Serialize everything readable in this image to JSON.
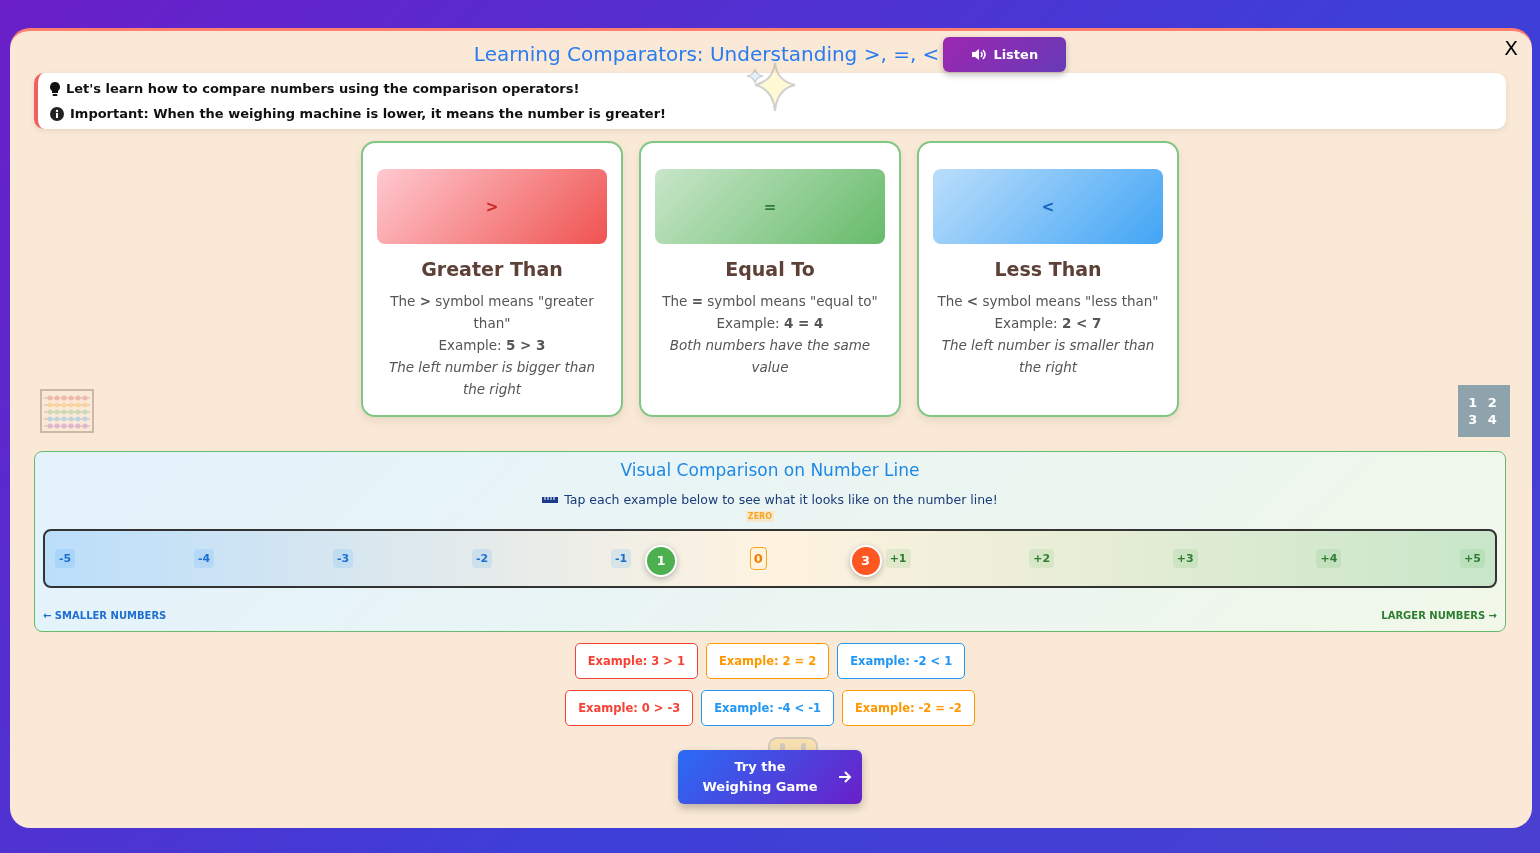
{
  "title": "Learning Comparators: Understanding >, =, <",
  "listen_button": "Listen",
  "close": "X",
  "info": [
    {
      "kind": "tip",
      "text": "Let's learn how to compare numbers using the comparison operators!"
    },
    {
      "kind": "important",
      "text": "Important: When the weighing machine is lower, it means the number is greater!"
    }
  ],
  "cards": [
    {
      "kind": "greater",
      "symbol": ">",
      "title": "Greater Than",
      "description": "The **>** symbol means \"greater than\"",
      "example": "Example: **5 > 3**",
      "note": "The left number is bigger than the right"
    },
    {
      "kind": "equal",
      "symbol": "=",
      "title": "Equal To",
      "description": "The **=** symbol means \"equal to\"",
      "example": "Example: **4 = 4**",
      "note": "Both numbers have the same value"
    },
    {
      "kind": "less",
      "symbol": "<",
      "title": "Less Than",
      "description": "The **<** symbol means \"less than\"",
      "example": "Example: **2 < 7**",
      "note": "The left number is smaller than the right"
    }
  ],
  "decor_numbers": [
    "1 2",
    "3 4"
  ],
  "number_line": {
    "title": "Visual Comparison on Number Line",
    "hint": "Tap each example below to see what it looks like on the number line!",
    "zero_label": "ZERO",
    "ticks": [
      {
        "label": "-5",
        "kind": "negative"
      },
      {
        "label": "-4",
        "kind": "negative"
      },
      {
        "label": "-3",
        "kind": "negative"
      },
      {
        "label": "-2",
        "kind": "negative"
      },
      {
        "label": "-1",
        "kind": "negative",
        "marker": {
          "label": "1",
          "color": "#4caf50",
          "kind": "after"
        }
      },
      {
        "label": "0",
        "kind": "zero"
      },
      {
        "label": "+1",
        "kind": "positive",
        "marker": {
          "label": "3",
          "color": "#ff5722",
          "kind": "before"
        }
      },
      {
        "label": "+2",
        "kind": "positive"
      },
      {
        "label": "+3",
        "kind": "positive"
      },
      {
        "label": "+4",
        "kind": "positive"
      },
      {
        "label": "+5",
        "kind": "positive"
      }
    ],
    "left_caption": "← SMALLER NUMBERS",
    "right_caption": "LARGER NUMBERS →"
  },
  "examples": [
    [
      {
        "label": "Example: 3 > 1",
        "color": "#f44336"
      },
      {
        "label": "Example: 2 = 2",
        "color": "#ff9800"
      },
      {
        "label": "Example: -2 < 1",
        "color": "#2196f3"
      }
    ],
    [
      {
        "label": "Example: 0 > -3",
        "color": "#f44336"
      },
      {
        "label": "Example: -4 < -1",
        "color": "#2196f3"
      },
      {
        "label": "Example: -2 = -2",
        "color": "#ff9800"
      }
    ]
  ],
  "game_button": "Try the Weighing Game"
}
